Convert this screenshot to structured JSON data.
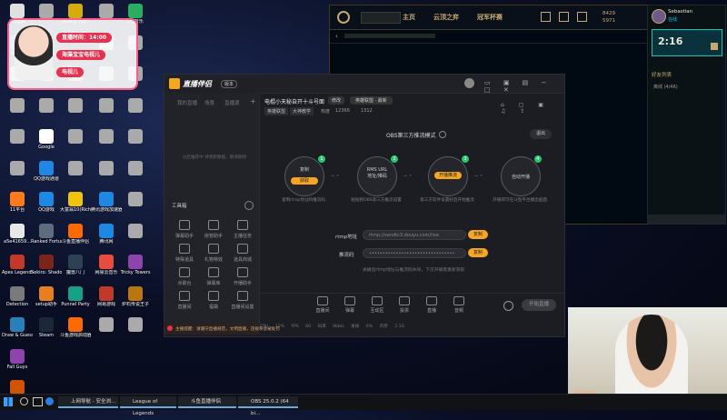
{
  "desktop": {
    "icons_col1": [
      {
        "label": "Google",
        "color": "#e0e0e0"
      },
      {
        "label": "Super",
        "color": "#3a6fd8"
      },
      {
        "label": "",
        "color": "#aaaaaa"
      },
      {
        "label": "",
        "color": "#aaaaaa"
      },
      {
        "label": "",
        "color": "#aaaaaa"
      },
      {
        "label": "",
        "color": "#aaaaaa"
      },
      {
        "label": "11平台",
        "color": "#ff7a1a"
      },
      {
        "label": "a5e41659...",
        "color": "#e8e8e8"
      },
      {
        "label": "Apex Legends",
        "color": "#c0392b"
      },
      {
        "label": "Detection",
        "color": "#7a7a7a"
      },
      {
        "label": "Draw & Guess",
        "color": "#2980b9"
      },
      {
        "label": "Fall Guys",
        "color": "#8e44ad"
      },
      {
        "label": "Flash Replay",
        "color": "#d35400"
      }
    ],
    "icons_col2": [
      {
        "label": "",
        "color": "#aaaaaa"
      },
      {
        "label": "WPS Office",
        "color": "#c0392b"
      },
      {
        "label": "",
        "color": "#aaaaaa"
      },
      {
        "label": "",
        "color": "#aaaaaa"
      },
      {
        "label": "Google",
        "color": "#ffffff"
      },
      {
        "label": "QQ游戏通道",
        "color": "#1e88e5"
      },
      {
        "label": "QQ游戏",
        "color": "#1e88e5"
      },
      {
        "label": "Ranked Fortune",
        "color": "#5d6d7e"
      },
      {
        "label": "Sekiro: Shadows...",
        "color": "#7b241c"
      },
      {
        "label": "setup助手",
        "color": "#e67e22"
      },
      {
        "label": "Steam",
        "color": "#1b2838"
      }
    ],
    "icons_col3": [
      {
        "label": "Buddy Man",
        "color": "#d4ac0d"
      },
      {
        "label": "",
        "color": "#aaaaaa"
      },
      {
        "label": "",
        "color": "#aaaaaa"
      },
      {
        "label": "",
        "color": "#aaaaaa"
      },
      {
        "label": "",
        "color": "#aaaaaa"
      },
      {
        "label": "",
        "color": "#aaaaaa"
      },
      {
        "label": "大富翁10(Rich...",
        "color": "#f1c40f"
      },
      {
        "label": "斗鱼直播伴侣",
        "color": "#ff6a00"
      },
      {
        "label": "魔兽八门",
        "color": "#2e4053"
      },
      {
        "label": "Punnel Party",
        "color": "#16a085"
      },
      {
        "label": "斗鱼游戏启动器",
        "color": "#ff6a00"
      }
    ],
    "icons_col4": [
      {
        "label": "",
        "color": "#aaaaaa"
      },
      {
        "label": "",
        "color": "#aaaaaa"
      },
      {
        "label": "",
        "color": "#aaaaaa"
      },
      {
        "label": "",
        "color": "#aaaaaa"
      },
      {
        "label": "",
        "color": "#aaaaaa"
      },
      {
        "label": "",
        "color": "#aaaaaa"
      },
      {
        "label": "腾讯游戏加速器",
        "color": "#1e88e5"
      },
      {
        "label": "腾讯网",
        "color": "#1e88e5"
      },
      {
        "label": "网易云音乐",
        "color": "#e74c3c"
      },
      {
        "label": "网易游戏",
        "color": "#c0392b"
      },
      {
        "label": "",
        "color": "#aaaaaa"
      }
    ],
    "icons_col5": [
      {
        "label": "QQ音乐",
        "color": "#27ae60"
      },
      {
        "label": "",
        "color": "#aaaaaa"
      },
      {
        "label": "",
        "color": "#aaaaaa"
      },
      {
        "label": "",
        "color": "#aaaaaa"
      },
      {
        "label": "",
        "color": "#aaaaaa"
      },
      {
        "label": "",
        "color": "#aaaaaa"
      },
      {
        "label": "",
        "color": "#aaaaaa"
      },
      {
        "label": "",
        "color": "#aaaaaa"
      },
      {
        "label": "Tricky Towers",
        "color": "#8e44ad"
      },
      {
        "label": "炉石传说王子",
        "color": "#b9770e"
      },
      {
        "label": "",
        "color": "#aaaaaa"
      }
    ]
  },
  "widget": {
    "time_label": "直播时间：14:00",
    "line1": "海藻宝宝电视儿",
    "line2": "电视儿"
  },
  "lol": {
    "search_placeholder": "",
    "nav_home": "主页",
    "nav_tft": "云顶之弈",
    "nav_champions": "冠军杯赛",
    "currency_be": "8429",
    "currency_rp": "5971",
    "username": "Sebastian",
    "status": "在线",
    "timer": "2:16",
    "friends_header": "好友列表",
    "group_label": "离线 (4/46)"
  },
  "app": {
    "brand": "直播伴侣",
    "brand_badge": "版本",
    "tabs": [
      "我的直播",
      "场景",
      "直播源"
    ],
    "room_title": "电棍小天秘自开十斗号面",
    "edit_btn": "修改",
    "category_btn": "英雄联盟 · 最新",
    "tag1": "英雄联盟",
    "tag2": "大神教学",
    "stat_label": "热度",
    "stat_value": "12366",
    "stat_count": "1312",
    "side_empty": "分区推荐中 待更新数据，敬请期待",
    "tools_header": "工具箱",
    "tools": [
      "弹幕助手",
      "房管助手",
      "主播任务",
      "特殊道具",
      "礼物特效",
      "道具商城",
      "点歌台",
      "弹幕库",
      "开播助手",
      "直播间",
      "福袋",
      "直播间设置"
    ],
    "obs_title": "OBS第三方推流模式",
    "exit_btn": "退出",
    "steps": [
      {
        "num": "1",
        "btn": "获取",
        "top": "复制"
      },
      {
        "num": "2",
        "btn": "",
        "top": "RMS URL\n地址/推码"
      },
      {
        "num": "3",
        "btn": "开播推流",
        "top": ""
      },
      {
        "num": "4",
        "btn": "",
        "top": "自动开播"
      }
    ],
    "step_caps": [
      "复制rtmp地址和推流码",
      "粘贴到OBS第三方推流设置",
      "第三方软件设置好后开始推流",
      "开播即可在斗鱼平台播出画面"
    ],
    "rtmp_label": "rtmp地址",
    "rtmp_value": "rtmp://sendtc3.douyu.com/live",
    "key_label": "推流码",
    "key_value": "••••••••••••••••••••••••••••••••",
    "copy_btn": "复制",
    "hint": "关播后rtmp地址与推流码失效，下次开播需重新获取",
    "bottom_tools": [
      "直播间",
      "弹幕",
      "互动区",
      "投票",
      "直播",
      "音频"
    ],
    "start_btn": "开始直播",
    "status_bar": [
      "CPU 12%",
      "FPS 60",
      "码率 0kb/s",
      "丢帧 0%",
      "内存 2.1G"
    ],
    "notice": "主播提醒：请遵守直播规范，文明直播，违规将会被处罚"
  },
  "taskbar": {
    "items": [
      "上网导航 - 安全浏...",
      "League of Legends",
      "斗鱼直播伴侣",
      "OBS 25.0.2 (64 bi..."
    ]
  }
}
